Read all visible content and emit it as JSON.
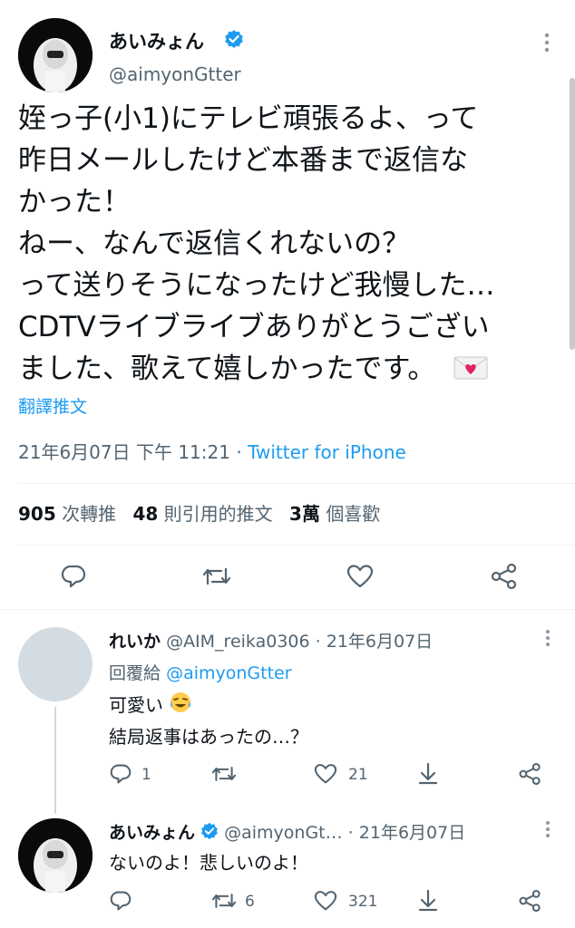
{
  "main_tweet": {
    "display_name": "あいみょん",
    "handle": "@aimyonGtter",
    "text_lines": [
      "姪っ子(小1)にテレビ頑張るよ、って",
      "昨日メールしたけど本番まで返信な",
      "かった！",
      "ねー、なんで返信くれないの？",
      "って送りそうになったけど我慢した…",
      "CDTVライブライブありがとうござい",
      "ました、歌えて嬉しかったです。"
    ],
    "translate_label": "翻譯推文",
    "timestamp": "21年6月07日 下午 11:21",
    "separator": "·",
    "source": "Twitter for iPhone",
    "stats": {
      "retweets_count": "905",
      "retweets_label": "次轉推",
      "quotes_count": "48",
      "quotes_label": "則引用的推文",
      "likes_count": "3萬",
      "likes_label": "個喜歡"
    }
  },
  "replies": [
    {
      "display_name": "れいか",
      "handle": "@AIM_reika0306",
      "separator": "·",
      "date": "21年6月07日",
      "reply_to_label": "回覆給",
      "reply_to_handle": "@aimyonGtter",
      "text_line_1": "可愛い",
      "text_line_2": "結局返事はあったの…？",
      "reply_count": "1",
      "retweet_count": "",
      "like_count": "21"
    },
    {
      "display_name": "あいみょん",
      "handle": "@aimyonGt…",
      "separator": "·",
      "date": "21年6月07日",
      "text_line_1": "ないのよ！悲しいのよ！",
      "reply_count": "",
      "retweet_count": "6",
      "like_count": "321"
    }
  ],
  "colors": {
    "accent": "#1d9bf0",
    "text": "#0f1419",
    "secondary": "#536471",
    "divider": "#eff3f4"
  }
}
